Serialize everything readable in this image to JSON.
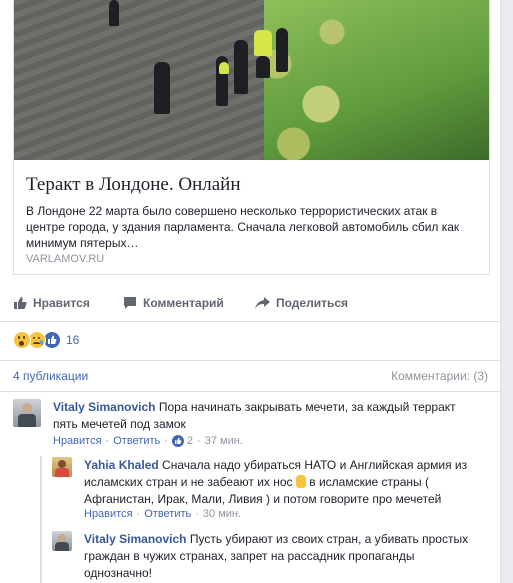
{
  "post": {
    "link": {
      "title": "Теракт в Лондоне. Онлайн",
      "description": "В Лондоне 22 марта было совершено несколько террористических атак в центре города, у здания парламента. Сначала легковой автомобиль сбил как минимум пятерых…",
      "domain": "VARLAMOV.RU"
    },
    "actions": {
      "like": "Нравится",
      "comment": "Комментарий",
      "share": "Поделиться"
    },
    "reactions": {
      "count": "16",
      "types": [
        "wow-icon",
        "sad-icon",
        "like-icon"
      ]
    },
    "shares": "4 публикации",
    "comments_label": "Комментарии: (3)"
  },
  "comments": [
    {
      "author": "Vitaly Simanovich",
      "text": "Пора начинать закрывать мечети, за каждый терракт пять мечетей под замок",
      "like_label": "Нравится",
      "reply_label": "Ответить",
      "likes": "2",
      "time": "37 мин."
    },
    {
      "author": "Yahia Khaled",
      "text_before": "Сначала надо убираться НАТО и Английская армия из исламских стран и не забеают их нос",
      "text_after": "в исламские страны ( Афганистан, Ирак, Мали, Ливия ) и потом говорите про мечетей",
      "like_label": "Нравится",
      "reply_label": "Ответить",
      "time": "30 мин."
    },
    {
      "author": "Vitaly Simanovich",
      "text": "Пусть убирают из своих стран, а убивать простых граждан в чужих странах, запрет на рассадник пропаганды однозначно!"
    }
  ],
  "colors": {
    "link": "#385898",
    "accent": "#4267b2",
    "meta": "#90949c",
    "divider": "#dddfe2"
  }
}
